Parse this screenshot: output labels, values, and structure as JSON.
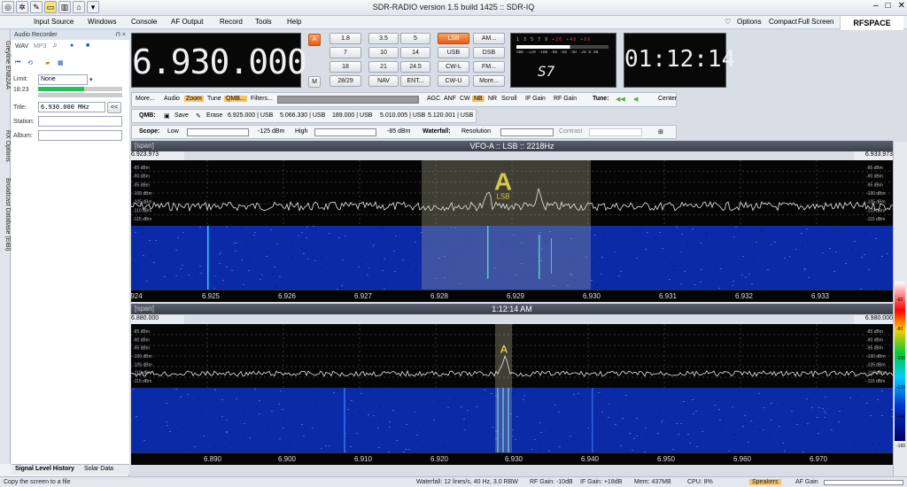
{
  "window": {
    "title": "SDR-RADIO version 1.5 build 1425 :: SDR-IQ"
  },
  "menu": [
    "Input Source",
    "Windows",
    "Console",
    "AF Output",
    "Record",
    "Tools",
    "Help"
  ],
  "menu_right": {
    "options": "Options",
    "compact": "Compact",
    "fullscreen": "Full Screen",
    "brand": "RFSPACE"
  },
  "left_vtabs": [
    "Greyline EN82AA",
    "RX Options",
    "Broadcast Database (EiBi)"
  ],
  "audio_recorder": {
    "header": "Audio Recorder",
    "formats": [
      "WAV",
      "MP3"
    ],
    "limit_label": "Limit:",
    "limit_value": "None",
    "time": "18:23",
    "title_label": "Title:",
    "title_value": "6.930.000 MHz",
    "collapse_btn": "<<",
    "station_label": "Station:",
    "album_label": "Album:"
  },
  "left_tabs": [
    "Signal Level History",
    "Solar Data"
  ],
  "frequency_lcd": "6.930.000",
  "smeter_lcd": "S7",
  "smeter_scale": [
    "1",
    "3",
    "5",
    "7",
    "9",
    "+20",
    "+40",
    "+60",
    "dBm",
    "-120",
    "-100",
    "-80",
    "-60",
    "-40",
    "-20",
    "0",
    "dB"
  ],
  "clock_lcd": "01:12:14",
  "vfo_a_btn": "A",
  "vfo_m_btn": "M",
  "keypad": [
    "1.8",
    "3.5",
    "5",
    "7",
    "10",
    "14",
    "18",
    "21",
    "24.5",
    "28/29",
    "NAV",
    "ENT..."
  ],
  "modes": [
    [
      "LSB",
      "AM..."
    ],
    [
      "USB",
      "DSB"
    ],
    [
      "CW-L",
      "FM..."
    ],
    [
      "CW-U",
      "More..."
    ]
  ],
  "strip1": {
    "more": "More...",
    "audio": "Audio",
    "zoom": "Zoom",
    "tune": "Tune",
    "qmb": "QMB...",
    "filters": "Filters...",
    "agc": "AGC",
    "anf": "ANF",
    "cw": "CW",
    "nb": "NB",
    "nr": "NR",
    "scroll": "Scroll",
    "if_gain": "IF Gain",
    "rf_gain": "RF Gain",
    "tune_label": "Tune:",
    "center": "Center"
  },
  "strip2": {
    "qmb": "QMB:",
    "save": "Save",
    "erase": "Erase",
    "memories": [
      "6.925.000 | USB",
      "5.066.330 | USB",
      "189.000 | USB",
      "5.010.005 | USB",
      "5.120.001 | USB"
    ]
  },
  "strip3": {
    "scope": "Scope:",
    "low": "Low",
    "low_val": "-125 dBm",
    "high": "High",
    "high_val": "-85 dBm",
    "waterfall": "Waterfall:",
    "resolution": "Resolution",
    "contrast": "Contrast"
  },
  "panel1": {
    "span": "[span]",
    "title": "VFO-A  ::  LSB  ::  2218Hz",
    "left_freq": "6.923.973",
    "right_freq": "6.933.973",
    "marker": "A",
    "marker_mode": "LSB",
    "db_labels": [
      "-85 dBm",
      "-90 dBm",
      "-95 dBm",
      "-100 dBm",
      "-105 dBm",
      "-110 dBm",
      "-115 dBm"
    ],
    "x_ticks": [
      "924",
      "6.925",
      "6.926",
      "6.927",
      "6.928",
      "6.929",
      "6.930",
      "6.931",
      "6.932",
      "6.933"
    ]
  },
  "panel2": {
    "span": "[span]",
    "title": "1:12:14 AM",
    "left_freq": "6.880.000",
    "right_freq": "6.980.000",
    "marker": "A",
    "db_labels": [
      "-85 dBm",
      "-90 dBm",
      "-95 dBm",
      "-100 dBm",
      "-105 dBm",
      "-110 dBm",
      "-115 dBm"
    ],
    "x_ticks": [
      "6.890",
      "6.900",
      "6.910",
      "6.920",
      "6.930",
      "6.940",
      "6.950",
      "6.960",
      "6.970"
    ]
  },
  "colorbar_labels": [
    "-60",
    "-80",
    "-100",
    "-120",
    "-140",
    "-160"
  ],
  "status": {
    "left": "Copy the screen to a file",
    "waterfall": "Waterfall: 12 lines/s, 40 Hz, 3.0 RBW",
    "rf_gain": "RF Gain: -10dB",
    "if_gain": "IF Gain: +18dB",
    "mem": "Mem: 437MB",
    "cpu": "CPU: 8%",
    "speakers": "Speakers",
    "af_gain": "AF Gain"
  },
  "colors": {
    "accent": "#e65b15",
    "spectrum_bg": "#050505",
    "waterfall": "#0a2aa8",
    "lcd_bg": "#080808"
  }
}
